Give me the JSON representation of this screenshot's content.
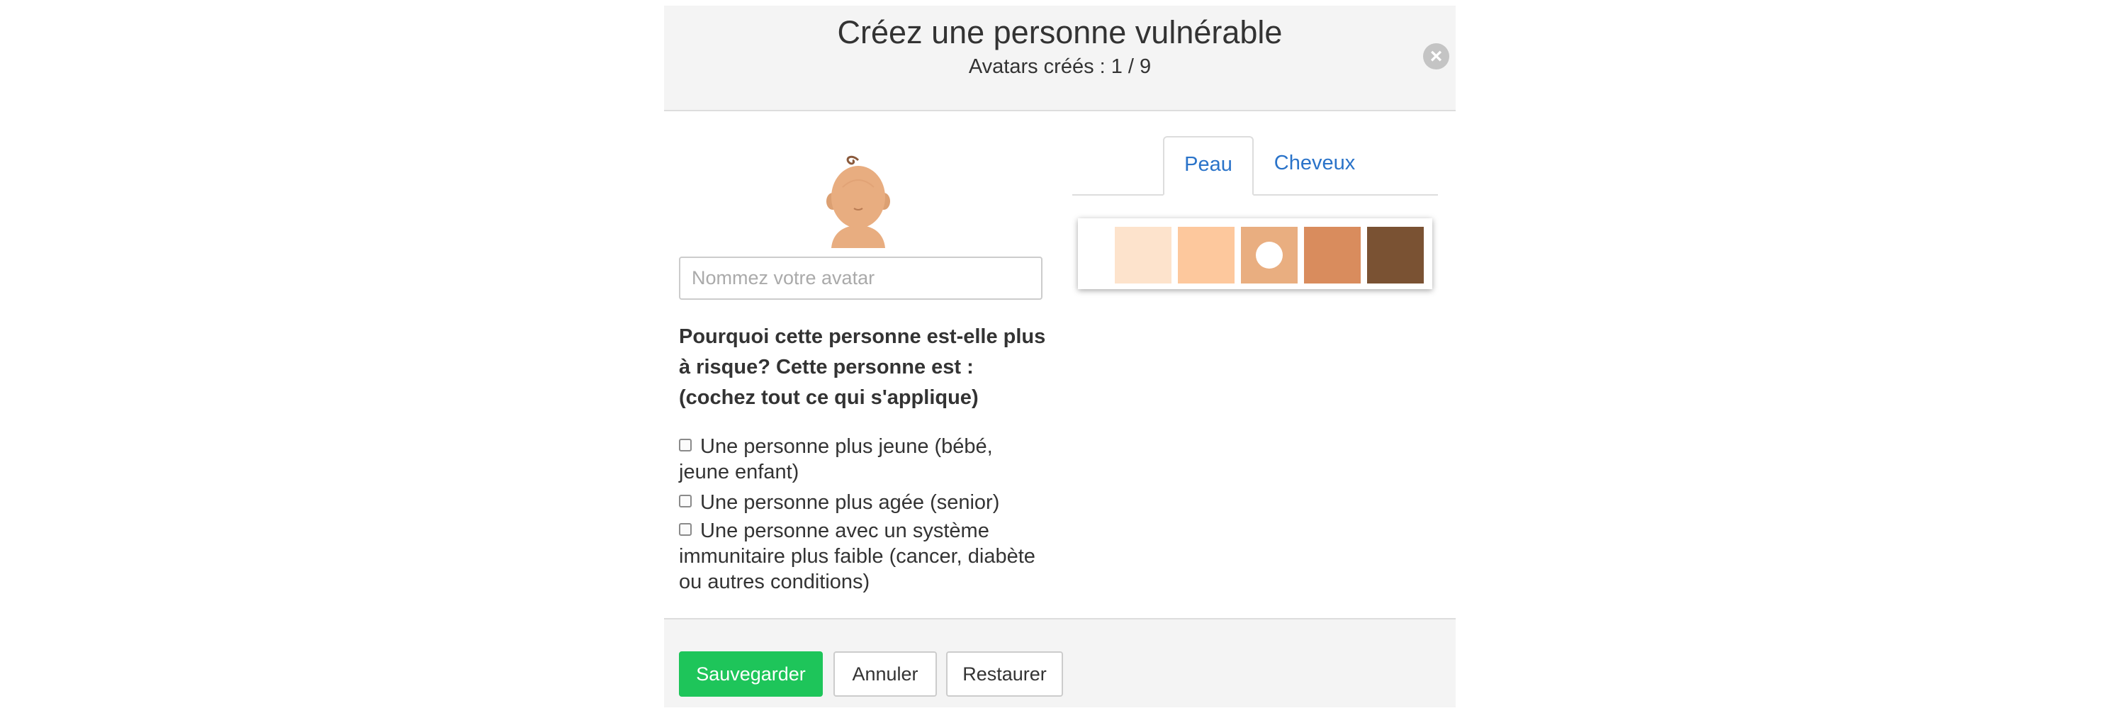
{
  "modal": {
    "title": "Créez une personne vulnérable",
    "subtitle": "Avatars créés : 1 / 9",
    "close_icon": "close-icon"
  },
  "avatar": {
    "icon": "baby-avatar-icon",
    "name_placeholder": "Nommez votre avatar",
    "name_value": ""
  },
  "question": {
    "line1": "Pourquoi cette personne est-elle plus",
    "line2": "à risque? Cette personne est :",
    "line3": "(cochez tout ce qui s'applique)"
  },
  "options": [
    {
      "line1": "Une personne plus jeune (bébé,",
      "line2": "jeune enfant)",
      "checked": false
    },
    {
      "line1": "Une personne plus agée (senior)",
      "checked": false
    },
    {
      "line1": "Une personne avec un système",
      "line2": "immunitaire plus faible (cancer, diabète",
      "line3": "ou autres conditions)",
      "checked": false
    }
  ],
  "tabs": [
    {
      "label": "Peau",
      "active": true
    },
    {
      "label": "Cheveux",
      "active": false
    }
  ],
  "skin_swatches": [
    {
      "color": "#ffffff",
      "selected": false
    },
    {
      "color": "#fde3cc",
      "selected": false
    },
    {
      "color": "#fdc89d",
      "selected": false
    },
    {
      "color": "#e9ae80",
      "selected": true
    },
    {
      "color": "#d98c5d",
      "selected": false
    },
    {
      "color": "#7a5233",
      "selected": false
    }
  ],
  "footer": {
    "save_label": "Sauvegarder",
    "cancel_label": "Annuler",
    "restore_label": "Restaurer"
  },
  "colors": {
    "accent_green": "#1ec55a",
    "tab_link": "#2a73c9",
    "header_bg": "#f4f4f4"
  }
}
